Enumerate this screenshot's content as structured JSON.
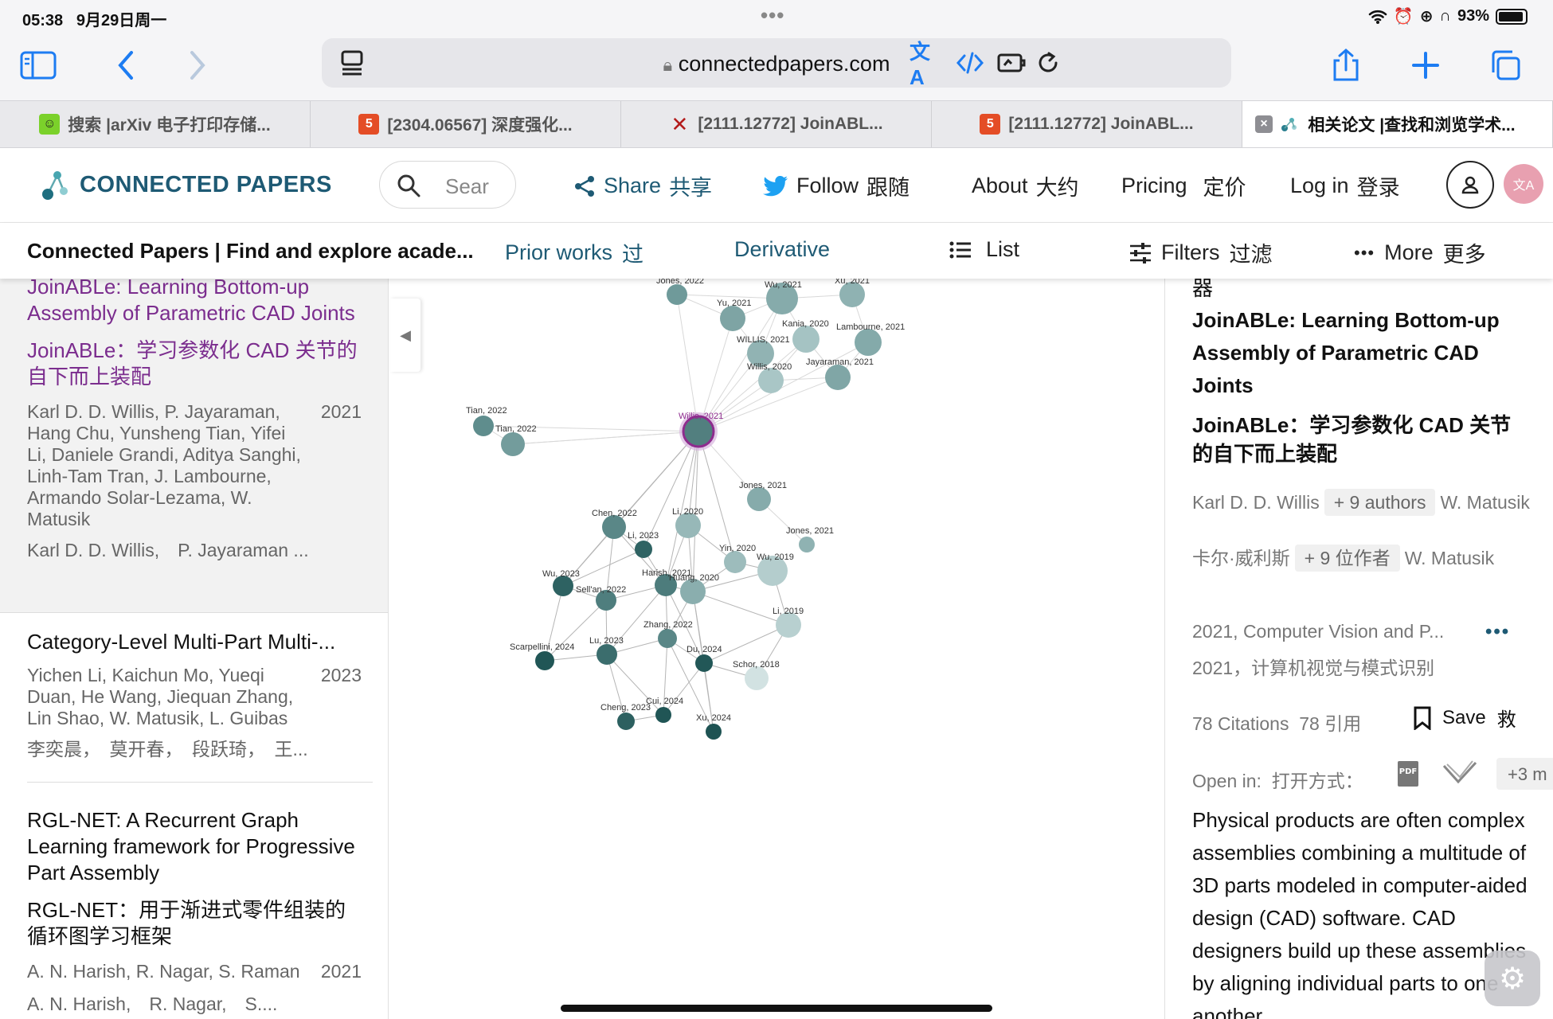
{
  "status": {
    "time": "05:38",
    "date": "9月29日周一",
    "battery": "93%",
    "battery_level": 0.93
  },
  "browser": {
    "url": "connectedpapers.com",
    "tabs": [
      {
        "label": "搜索 |arXiv 电子打印存储...",
        "icon": "arxiv-smiley-icon"
      },
      {
        "label": "[2304.06567] 深度强化...",
        "icon": "html5-icon"
      },
      {
        "label": "[2111.12772] JoinABL...",
        "icon": "arxiv-x-icon"
      },
      {
        "label": "[2111.12772] JoinABL...",
        "icon": "html5-icon"
      },
      {
        "label": "相关论文 |查找和浏览学术...",
        "icon": "connected-papers-icon"
      }
    ]
  },
  "site": {
    "logo": "CONNECTED PAPERS",
    "search_placeholder": "Sear",
    "nav": {
      "share": "Share",
      "share_zh": "共享",
      "follow": "Follow",
      "follow_zh": "跟随",
      "about": "About",
      "about_zh": "大约",
      "pricing": "Pricing",
      "pricing_zh": "定价",
      "login": "Log in",
      "login_zh": "登录"
    }
  },
  "subnav": {
    "title": "Connected Papers | Find and explore acade...",
    "prior": "Prior works",
    "prior_zh": "过",
    "derivative": "Derivative",
    "list": "List",
    "filters": "Filters",
    "filters_zh": "过滤",
    "filters_zh2": "器",
    "more": "More",
    "more_zh": "更多"
  },
  "list": [
    {
      "title": "JoinABLe: Learning Bottom-up Assembly of Parametric CAD Joints",
      "title_zh": "JoinABLe：学习参数化 CAD 关节的自下而上装配",
      "authors": "Karl D. D. Willis, P. Jayaraman, Hang Chu, Yunsheng Tian, Yifei Li, Daniele Grandi, Aditya Sanghi, Linh-Tam Tran, J. Lambourne, Armando Solar-Lezama, W. Matusik",
      "year": "2021",
      "authors_short": "Karl D. D. Willis,　P. Jayaraman ..."
    },
    {
      "title": "Category-Level Multi-Part Multi-...",
      "authors": "Yichen Li, Kaichun Mo, Yueqi Duan, He Wang, Jiequan Zhang, Lin Shao, W. Matusik, L. Guibas",
      "year": "2023",
      "authors_short": "李奕晨，　莫开春，　段跃琦，　王..."
    },
    {
      "title": "RGL-NET: A Recurrent Graph Learning framework for Progressive Part Assembly",
      "title_zh": "RGL-NET：用于渐进式零件组装的循环图学习框架",
      "authors": "A. N. Harish, R. Nagar, S. Raman",
      "year": "2021",
      "authors_short": "A. N. Harish,　R. Nagar,　S...."
    }
  ],
  "graph": {
    "nodes": [
      {
        "label": "Jones, 2022",
        "tone": "#6f9a9a"
      },
      {
        "label": "Wu, 2021",
        "tone": "#86abab"
      },
      {
        "label": "Xu, 2021",
        "tone": "#8fb2b2"
      },
      {
        "label": "Yu, 2021",
        "tone": "#7ea4a4"
      },
      {
        "label": "Kania, 2020",
        "tone": "#a5c3c3"
      },
      {
        "label": "Lambourne, 2021",
        "tone": "#84aaaa"
      },
      {
        "label": "WILLIS, 2021",
        "tone": "#91b3b3"
      },
      {
        "label": "Willis, 2020",
        "tone": "#a9c6c6"
      },
      {
        "label": "Jayaraman, 2021",
        "tone": "#80a6a6"
      },
      {
        "label": "Tian, 2022",
        "tone": "#5f8d8d"
      },
      {
        "label": "Tian, 2022",
        "tone": "#739c9c"
      },
      {
        "label": "Willis, 2021",
        "tone": "#527f7f",
        "selected": true
      },
      {
        "label": "Jones, 2021",
        "tone": "#86abab"
      },
      {
        "label": "Jones, 2021",
        "tone": "#8fb2b2"
      },
      {
        "label": "Chen, 2022",
        "tone": "#5a8787"
      },
      {
        "label": "Li, 2020",
        "tone": "#97b8b8"
      },
      {
        "label": "Li, 2023",
        "tone": "#2f6363"
      },
      {
        "label": "Yin, 2020",
        "tone": "#9dbcbc"
      },
      {
        "label": "Wu, 2019",
        "tone": "#b4cdcd"
      },
      {
        "label": "Wu, 2023",
        "tone": "#2e6262"
      },
      {
        "label": "Harish, 2021",
        "tone": "#4d7c7c"
      },
      {
        "label": "Huang, 2020",
        "tone": "#8aaeae"
      },
      {
        "label": "Sell'an, 2022",
        "tone": "#4f7e7e"
      },
      {
        "label": "Li, 2019",
        "tone": "#b8d0d0"
      },
      {
        "label": "Zhang, 2022",
        "tone": "#5a8787"
      },
      {
        "label": "Lu, 2023",
        "tone": "#3b6d6d"
      },
      {
        "label": "Scarpellini, 2024",
        "tone": "#215656"
      },
      {
        "label": "Du, 2024",
        "tone": "#225757"
      },
      {
        "label": "Schor, 2018",
        "tone": "#d2e2e2"
      },
      {
        "label": "Cui, 2024",
        "tone": "#205555"
      },
      {
        "label": "Cheng, 2023",
        "tone": "#2c6060"
      },
      {
        "label": "Xu, 2024",
        "tone": "#1e5353"
      }
    ]
  },
  "detail": {
    "filters_tail": "器",
    "title": "JoinABLe: Learning Bottom-up Assembly of Parametric CAD Joints",
    "title_zh": "JoinABLe：学习参数化 CAD 关节的自下而上装配",
    "author_first": "Karl D. D. Willis",
    "more_authors": "+ 9 authors",
    "author_last": "W. Matusik",
    "author_first_zh": "卡尔·威利斯",
    "more_authors_zh": "+ 9 位作者",
    "author_last_zh": "W. Matusik",
    "venue": "2021, Computer Vision and P...",
    "venue_zh": "2021，计算机视觉与模式识别",
    "citations": "78 Citations",
    "citations_zh": "78 引用",
    "save": "Save",
    "save_zh": "救",
    "open_in": "Open in:",
    "open_in_zh": "打开方式：",
    "open_more": "+3 m",
    "abstract": "Physical products are often complex assemblies combining a multitude of 3D parts modeled in computer-aided design (CAD) software. CAD designers build up these assemblies by aligning individual parts to one another"
  }
}
